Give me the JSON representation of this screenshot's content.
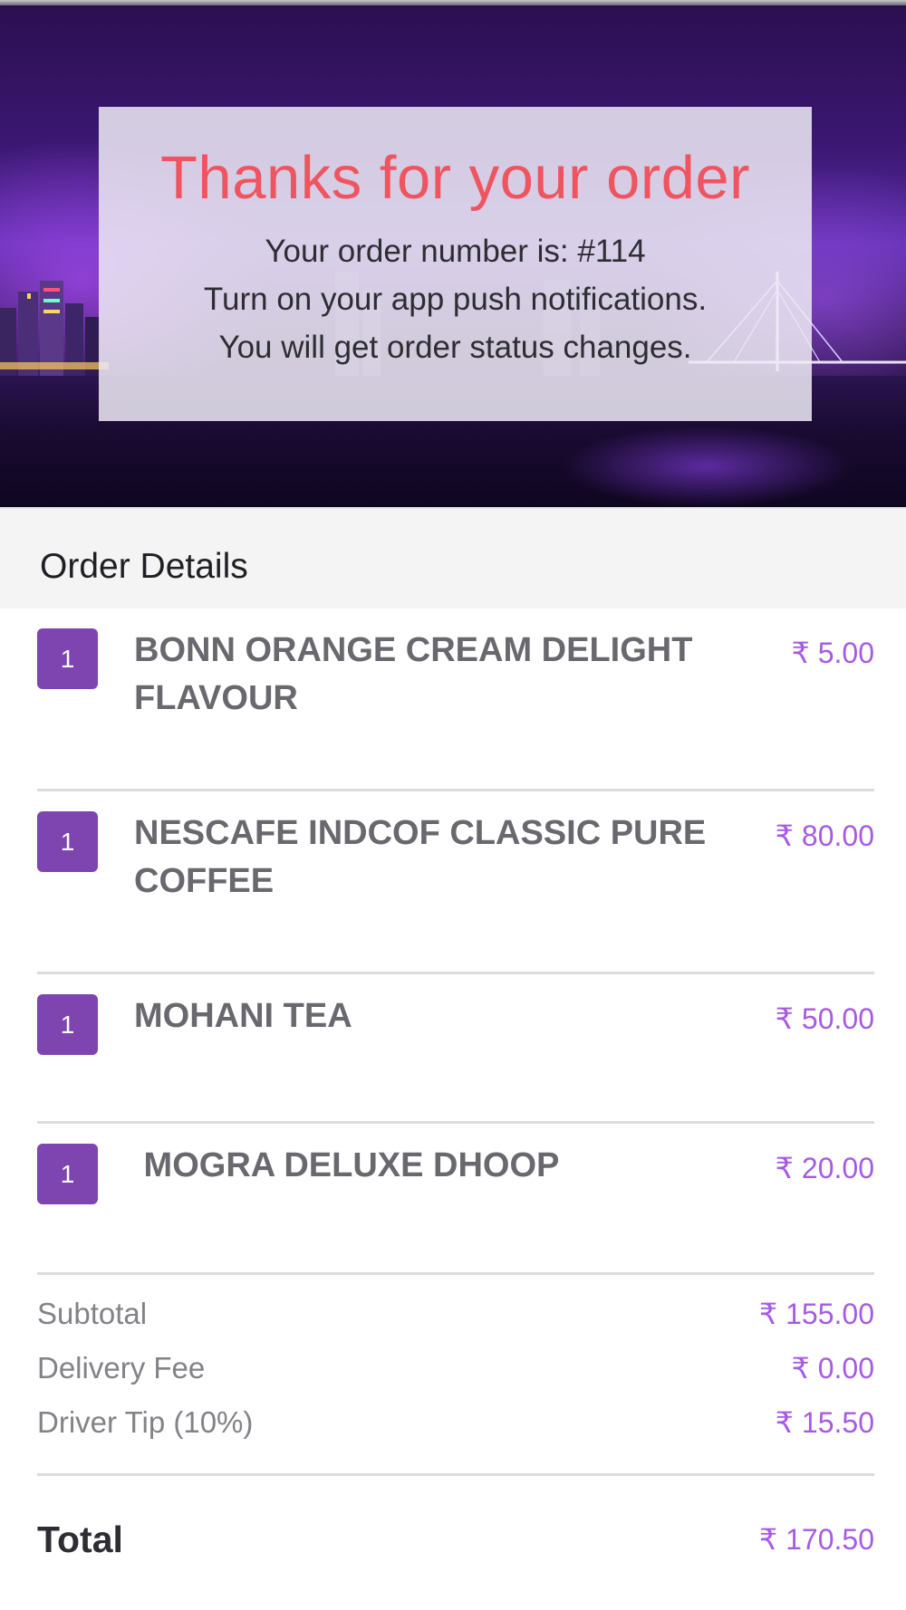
{
  "hero": {
    "title": "Thanks for your order",
    "order_number_line": "Your order number is: #114",
    "push_line": "Turn on your app push notifications.",
    "status_line": "You will get order status changes."
  },
  "order_details": {
    "heading": "Order Details",
    "items": [
      {
        "qty": "1",
        "name": "BONN ORANGE CREAM DELIGHT FLAVOUR",
        "price": "₹ 5.00"
      },
      {
        "qty": "1",
        "name": "NESCAFE INDCOF CLASSIC  PURE COFFEE",
        "price": "₹ 80.00"
      },
      {
        "qty": "1",
        "name": "MOHANI TEA",
        "price": "₹ 50.00"
      },
      {
        "qty": "1",
        "name": " MOGRA DELUXE DHOOP",
        "price": "₹ 20.00"
      }
    ]
  },
  "summary": {
    "subtotal_label": "Subtotal",
    "subtotal_value": "₹ 155.00",
    "delivery_label": "Delivery Fee",
    "delivery_value": "₹ 0.00",
    "tip_label": "Driver Tip (10%)",
    "tip_value": "₹ 15.50",
    "total_label": "Total",
    "total_value": "₹ 170.50"
  },
  "colors": {
    "accent": "#7e44b0",
    "price": "#a65be3",
    "title": "#ef5560"
  }
}
